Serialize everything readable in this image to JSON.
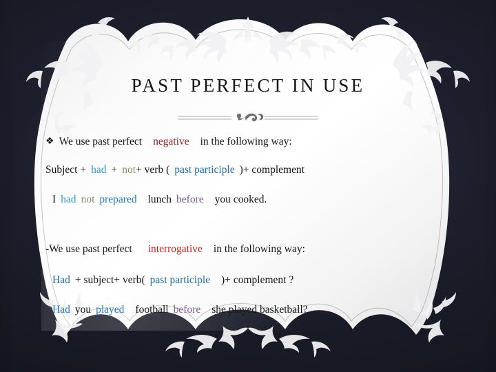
{
  "slide": {
    "title": "PAST PERFECT IN USE",
    "bullet_glyph": "❖",
    "colors": {
      "background_dark": "#1b1d2a",
      "panel_cream": "#fbfbfb",
      "title_text": "#16161a",
      "body_text": "#15151a",
      "accent_red_dark": "#9e2222",
      "accent_red_bright": "#cc1f1f",
      "accent_blue_light": "#2f9bd8",
      "accent_blue_dark": "#1f6fa8",
      "accent_khaki": "#8a8a62",
      "accent_purple": "#7b5ca0"
    }
  },
  "content": {
    "line1": {
      "a": "We use past perfect",
      "b": "negative",
      "c": "in the following way:"
    },
    "line2": {
      "a": "Subject +",
      "b": "had",
      "c": "+",
      "d": "not",
      "e": "+ verb (",
      "f": "past participle",
      "g": ")+ complement"
    },
    "line3": {
      "a": "I",
      "b": "had",
      "c": "not",
      "d": "prepared",
      "e": "lunch",
      "f": "before",
      "g": "you cooked."
    },
    "line4": {
      "a": "-We use past perfect",
      "b": "interrogative",
      "c": "in the following way:"
    },
    "line5": {
      "a": "Had",
      "b": "+ subject+ verb(",
      "c": "past participle",
      "d": ")+ complement ?"
    },
    "line6": {
      "a": "Had",
      "b": "you",
      "c": "played",
      "d": "football",
      "e": "before",
      "f": "she played basketball?"
    }
  }
}
